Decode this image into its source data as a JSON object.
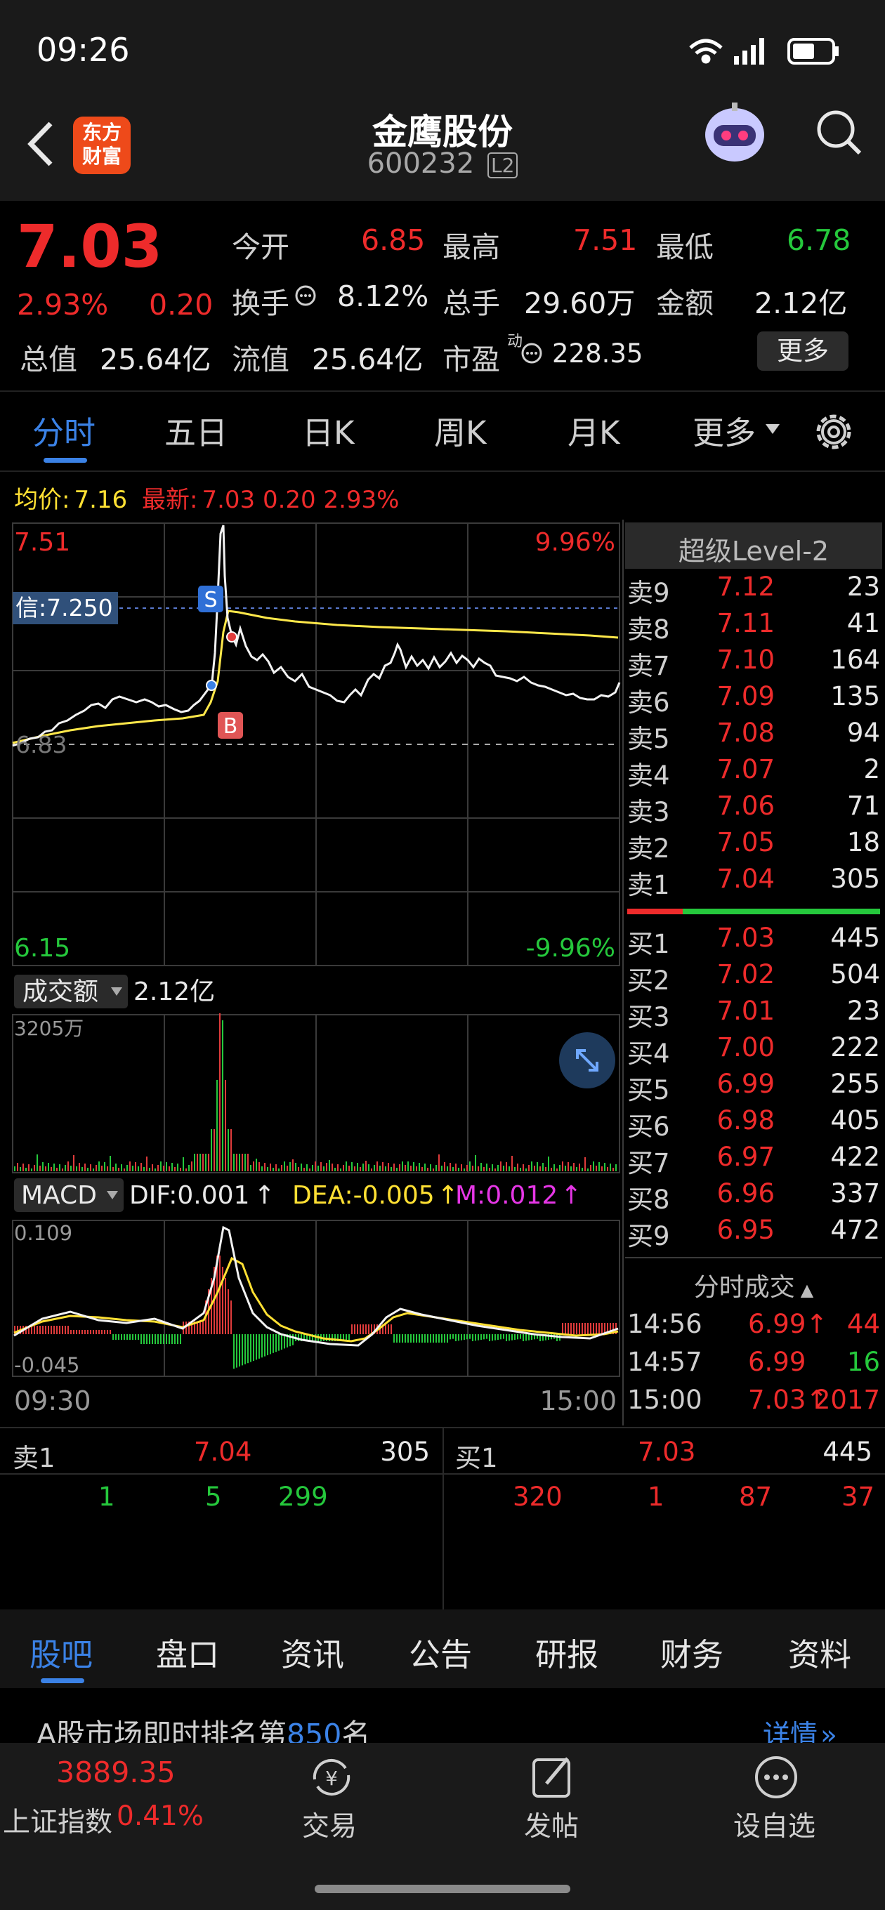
{
  "status_bar": {
    "time": "09:26"
  },
  "header": {
    "stock_name": "金鹰股份",
    "stock_code": "600232",
    "level_badge": "L2",
    "app_logo": "东方\n财富"
  },
  "quote": {
    "price": "7.03",
    "change_pct": "2.93%",
    "change": "0.20",
    "open_label": "今开",
    "open": "6.85",
    "high_label": "最高",
    "high": "7.51",
    "low_label": "最低",
    "low": "6.78",
    "turnover_label": "换手",
    "turnover": "8.12%",
    "volume_label": "总手",
    "volume": "29.60万",
    "amount_label": "金额",
    "amount": "2.12亿",
    "mktcap_label": "总值",
    "mktcap": "25.64亿",
    "float_label": "流值",
    "float": "25.64亿",
    "pe_label": "市盈",
    "pe_sup": "动",
    "pe": "228.35",
    "more_button": "更多"
  },
  "tabs": [
    "分时",
    "五日",
    "日K",
    "周K",
    "月K",
    "更多"
  ],
  "chart_header": {
    "avg_label": "均价:",
    "avg": "7.16",
    "last_label": "最新:",
    "last": "7.03 0.20 2.93%"
  },
  "main_chart": {
    "top_price": "7.51",
    "bottom_price": "6.15",
    "top_pct": "9.96%",
    "bottom_pct": "-9.96%",
    "signal_label": "信:7.250",
    "prev_close_label": "6.83",
    "s_marker": "S",
    "b_marker": "B"
  },
  "volume_panel": {
    "selector": "成交额",
    "value": "2.12亿",
    "max_label": "3205万"
  },
  "macd_panel": {
    "selector": "MACD",
    "dif": "DIF:0.001",
    "dea": "DEA:-0.005",
    "m": "M:0.012",
    "arrow": "↑",
    "top": "0.109",
    "bottom": "-0.045"
  },
  "time_axis": {
    "start": "09:30",
    "end": "15:00"
  },
  "level2": {
    "title": "超级Level-2",
    "sells": [
      {
        "label": "卖9",
        "price": "7.12",
        "vol": "23"
      },
      {
        "label": "卖8",
        "price": "7.11",
        "vol": "41"
      },
      {
        "label": "卖7",
        "price": "7.10",
        "vol": "164"
      },
      {
        "label": "卖6",
        "price": "7.09",
        "vol": "135"
      },
      {
        "label": "卖5",
        "price": "7.08",
        "vol": "94"
      },
      {
        "label": "卖4",
        "price": "7.07",
        "vol": "2"
      },
      {
        "label": "卖3",
        "price": "7.06",
        "vol": "71"
      },
      {
        "label": "卖2",
        "price": "7.05",
        "vol": "18"
      },
      {
        "label": "卖1",
        "price": "7.04",
        "vol": "305"
      }
    ],
    "buys": [
      {
        "label": "买1",
        "price": "7.03",
        "vol": "445"
      },
      {
        "label": "买2",
        "price": "7.02",
        "vol": "504"
      },
      {
        "label": "买3",
        "price": "7.01",
        "vol": "23"
      },
      {
        "label": "买4",
        "price": "7.00",
        "vol": "222"
      },
      {
        "label": "买5",
        "price": "6.99",
        "vol": "255"
      },
      {
        "label": "买6",
        "price": "6.98",
        "vol": "405"
      },
      {
        "label": "买7",
        "price": "6.97",
        "vol": "422"
      },
      {
        "label": "买8",
        "price": "6.96",
        "vol": "337"
      },
      {
        "label": "买9",
        "price": "6.95",
        "vol": "472"
      }
    ],
    "trades_title": "分时成交",
    "trades": [
      {
        "time": "14:56",
        "price": "6.99",
        "arrow": "↑",
        "vol": "44"
      },
      {
        "time": "14:57",
        "price": "6.99",
        "arrow": "",
        "vol": "16"
      },
      {
        "time": "15:00",
        "price": "7.03",
        "arrow": "↑",
        "vol": "2017"
      }
    ]
  },
  "queue": {
    "sell_label": "卖1",
    "sell_price": "7.04",
    "sell_vol": "305",
    "buy_label": "买1",
    "buy_price": "7.03",
    "buy_vol": "445",
    "sell_orders": [
      "1",
      "5",
      "299"
    ],
    "buy_orders": [
      "320",
      "1",
      "87",
      "37"
    ]
  },
  "bottom_tabs": [
    "股吧",
    "盘口",
    "资讯",
    "公告",
    "研报",
    "财务",
    "资料"
  ],
  "ranking": {
    "prefix": "A股市场即时排名第",
    "rank": "850",
    "suffix": "名",
    "details": "详情"
  },
  "footer": {
    "index_value": "3889.35",
    "index_name": "上证指数",
    "index_change": "0.41%",
    "trade": "交易",
    "post": "发帖",
    "watch": "设自选"
  }
}
